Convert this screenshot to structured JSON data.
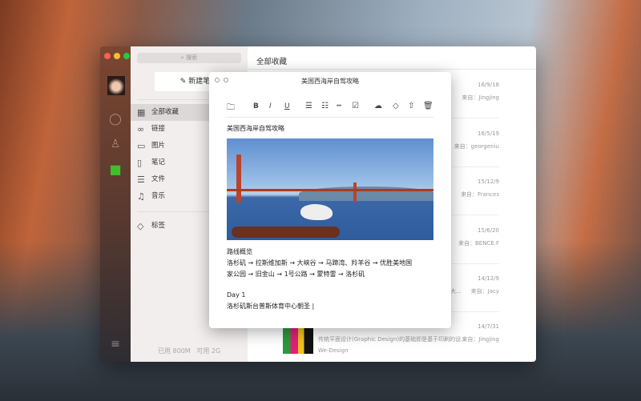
{
  "window": {
    "list_title": "全部收藏"
  },
  "sidebar": {
    "search_placeholder": "搜索",
    "new_note": "新建笔记",
    "items": [
      {
        "icon": "grid-icon",
        "glyph": "▦",
        "label": "全部收藏"
      },
      {
        "icon": "link-icon",
        "glyph": "∞",
        "label": "链接"
      },
      {
        "icon": "image-icon",
        "glyph": "▭",
        "label": "图片"
      },
      {
        "icon": "note-icon",
        "glyph": "▯",
        "label": "笔记"
      },
      {
        "icon": "file-icon",
        "glyph": "☰",
        "label": "文件"
      },
      {
        "icon": "music-icon",
        "glyph": "♫",
        "label": "音乐"
      }
    ],
    "tags": {
      "icon": "tag-icon",
      "glyph": "◇",
      "label": "标签"
    },
    "usage": "已用 800M   可用 2G"
  },
  "list": [
    {
      "date": "16/9/18",
      "from": "来自：Jingjing"
    },
    {
      "date": "16/5/19",
      "from": "来自：georgeniu"
    },
    {
      "date": "15/12/9",
      "from": "来自：Frances"
    },
    {
      "date": "15/6/20",
      "from": "来自：BENCE.F"
    },
    {
      "date": "14/12/9",
      "from": "来自：Jacy",
      "snippet": "大..."
    },
    {
      "date": "14/7/31",
      "from": "来自：Jingjing",
      "snippet": "传统平面设计(Graphic Design)的基础即是基于印刷的设...",
      "source": "We-Design"
    }
  ],
  "note": {
    "title": "美国西海岸自驾攻略",
    "heading": "美国西海岸自驾攻略",
    "toolbar": [
      "folder-icon",
      "bold",
      "italic",
      "underline",
      "bullet-list",
      "numbered-list",
      "divider",
      "checkbox",
      "cloud-upload-icon",
      "tag-icon",
      "share-icon",
      "trash-icon"
    ],
    "toolbar_labels": {
      "bold": "B",
      "italic": "I",
      "underline": "U"
    },
    "route_title": "路线概览",
    "route_line1": "洛杉矶 → 拉斯维加斯 → 大峡谷 → 马蹄湾、羚羊谷 → 优胜美地国",
    "route_line2": "家公园 → 旧金山 → 1号公路 → 蒙特雷 → 洛杉矶",
    "day": "Day 1",
    "day_text": "洛杉矶斯台普斯体育中心朝圣 |"
  },
  "colors": {
    "accent_green": "#3fbf2a",
    "close": "#fc5f57",
    "minimize": "#fdbc2e",
    "maximize": "#28c840"
  }
}
